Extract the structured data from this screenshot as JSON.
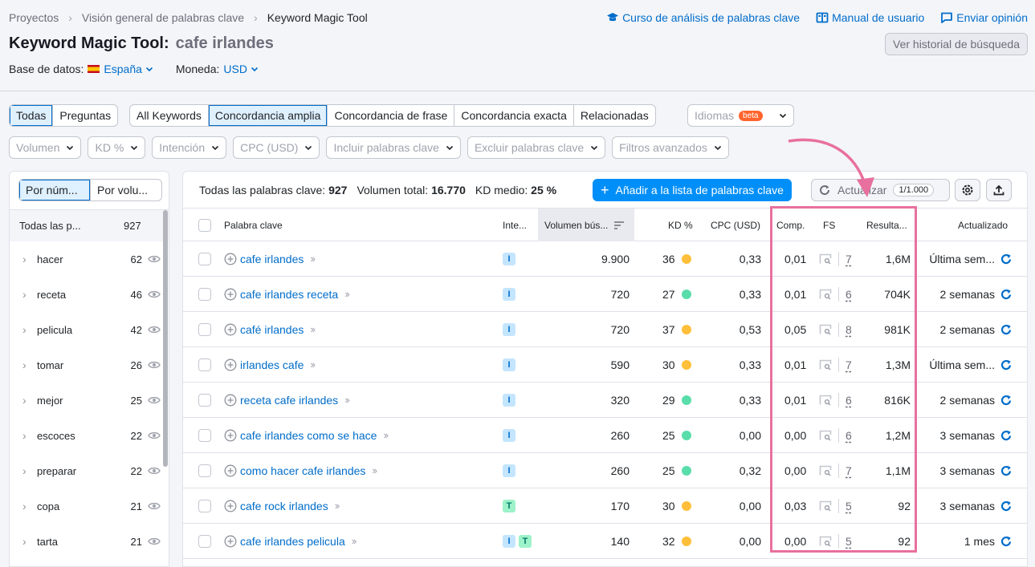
{
  "breadcrumb": [
    "Proyectos",
    "Visión general de palabras clave",
    "Keyword Magic Tool"
  ],
  "top_links": [
    {
      "icon": "graduation-cap-icon",
      "label": "Curso de análisis de palabras clave"
    },
    {
      "icon": "book-icon",
      "label": "Manual de usuario"
    },
    {
      "icon": "comment-icon",
      "label": "Enviar opinión"
    }
  ],
  "title": {
    "tool": "Keyword Magic Tool:",
    "query": "cafe irlandes"
  },
  "history_button": "Ver historial de búsqueda",
  "database": {
    "label": "Base de datos:",
    "value": "España"
  },
  "currency": {
    "label": "Moneda:",
    "value": "USD"
  },
  "question_tabs": [
    {
      "label": "Todas",
      "active": true
    },
    {
      "label": "Preguntas",
      "active": false
    }
  ],
  "match_tabs": [
    {
      "label": "All Keywords",
      "active": false
    },
    {
      "label": "Concordancia amplia",
      "active": true
    },
    {
      "label": "Concordancia de frase",
      "active": false
    },
    {
      "label": "Concordancia exacta",
      "active": false
    },
    {
      "label": "Relacionadas",
      "active": false
    }
  ],
  "languages": {
    "label": "Idiomas",
    "badge": "beta"
  },
  "filters": [
    "Volumen",
    "KD %",
    "Intención",
    "CPC (USD)",
    "Incluir palabras clave",
    "Excluir palabras clave",
    "Filtros avanzados"
  ],
  "sidebar": {
    "tabs": [
      {
        "label": "Por núm...",
        "active": true
      },
      {
        "label": "Por volu...",
        "active": false
      }
    ],
    "all": {
      "label": "Todas las p...",
      "count": "927"
    },
    "groups": [
      {
        "label": "hacer",
        "count": "62"
      },
      {
        "label": "receta",
        "count": "46"
      },
      {
        "label": "pelicula",
        "count": "42"
      },
      {
        "label": "tomar",
        "count": "26"
      },
      {
        "label": "mejor",
        "count": "25"
      },
      {
        "label": "escoces",
        "count": "22"
      },
      {
        "label": "preparar",
        "count": "22"
      },
      {
        "label": "copa",
        "count": "21"
      },
      {
        "label": "tarta",
        "count": "21"
      }
    ]
  },
  "summary": {
    "all_label": "Todas las palabras clave:",
    "all_value": "927",
    "volume_label": "Volumen total:",
    "volume_value": "16.770",
    "kd_label": "KD medio:",
    "kd_value": "25 %"
  },
  "actions": {
    "add": "Añadir a la lista de palabras clave",
    "update": "Actualizar",
    "update_quota": "1/1.000"
  },
  "columns": {
    "keyword": "Palabra clave",
    "intent": "Inte...",
    "volume": "Volumen bús...",
    "kd": "KD %",
    "cpc": "CPC (USD)",
    "comp": "Comp.",
    "fs": "FS",
    "results": "Resulta...",
    "updated": "Actualizado"
  },
  "colors": {
    "accent": "#006dca",
    "button": "#008ff8",
    "kd_yellow": "#ffbf3a",
    "kd_green": "#59ddaa",
    "highlight": "#e8709e"
  },
  "rows": [
    {
      "keyword": "cafe irlandes",
      "intents": [
        "I"
      ],
      "volume": "9.900",
      "kd": "36",
      "kd_color": "#ffbf3a",
      "cpc": "0,33",
      "comp": "0,01",
      "fs": "7",
      "results": "1,6M",
      "updated": "Última sem..."
    },
    {
      "keyword": "cafe irlandes receta",
      "intents": [
        "I"
      ],
      "volume": "720",
      "kd": "27",
      "kd_color": "#59ddaa",
      "cpc": "0,33",
      "comp": "0,01",
      "fs": "6",
      "results": "704K",
      "updated": "2 semanas"
    },
    {
      "keyword": "café irlandes",
      "intents": [
        "I"
      ],
      "volume": "720",
      "kd": "37",
      "kd_color": "#ffbf3a",
      "cpc": "0,53",
      "comp": "0,05",
      "fs": "8",
      "results": "981K",
      "updated": "2 semanas"
    },
    {
      "keyword": "irlandes cafe",
      "intents": [
        "I"
      ],
      "volume": "590",
      "kd": "30",
      "kd_color": "#ffbf3a",
      "cpc": "0,33",
      "comp": "0,01",
      "fs": "7",
      "results": "1,3M",
      "updated": "Última sem..."
    },
    {
      "keyword": "receta cafe irlandes",
      "intents": [
        "I"
      ],
      "volume": "320",
      "kd": "29",
      "kd_color": "#59ddaa",
      "cpc": "0,33",
      "comp": "0,01",
      "fs": "6",
      "results": "816K",
      "updated": "2 semanas"
    },
    {
      "keyword": "cafe irlandes como se hace",
      "intents": [
        "I"
      ],
      "volume": "260",
      "kd": "25",
      "kd_color": "#59ddaa",
      "cpc": "0,00",
      "comp": "0,00",
      "fs": "6",
      "results": "1,2M",
      "updated": "3 semanas"
    },
    {
      "keyword": "como hacer cafe irlandes",
      "intents": [
        "I"
      ],
      "volume": "260",
      "kd": "25",
      "kd_color": "#59ddaa",
      "cpc": "0,32",
      "comp": "0,00",
      "fs": "7",
      "results": "1,1M",
      "updated": "3 semanas"
    },
    {
      "keyword": "cafe rock irlandes",
      "intents": [
        "T"
      ],
      "volume": "170",
      "kd": "30",
      "kd_color": "#ffbf3a",
      "cpc": "0,00",
      "comp": "0,03",
      "fs": "5",
      "results": "92",
      "updated": "3 semanas"
    },
    {
      "keyword": "cafe irlandes pelicula",
      "intents": [
        "I",
        "T"
      ],
      "volume": "140",
      "kd": "32",
      "kd_color": "#ffbf3a",
      "cpc": "0,00",
      "comp": "0,00",
      "fs": "5",
      "results": "92",
      "updated": "1 mes"
    }
  ]
}
